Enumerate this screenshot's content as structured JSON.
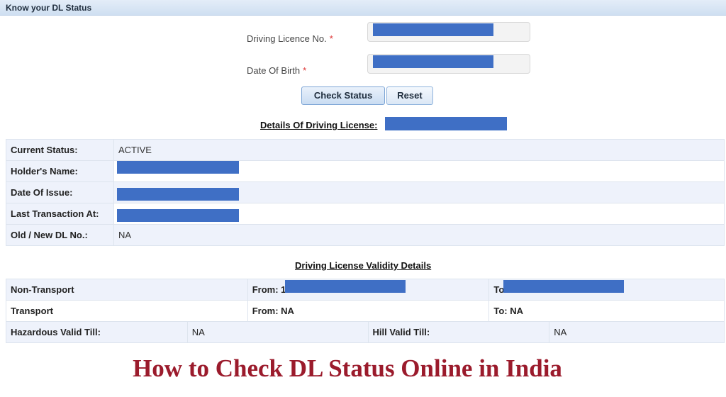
{
  "header": {
    "title": "Know your DL Status"
  },
  "form": {
    "licence_label": "Driving Licence No.",
    "dob_label": "Date Of Birth",
    "required_mark": "*",
    "check_button": "Check Status",
    "reset_button": "Reset"
  },
  "details": {
    "heading": "Details Of Driving License:",
    "rows": [
      {
        "label": "Current Status:",
        "value": "ACTIVE"
      },
      {
        "label": "Holder's Name:",
        "value": ""
      },
      {
        "label": "Date Of Issue:",
        "value": ""
      },
      {
        "label": "Last Transaction At:",
        "value": ""
      },
      {
        "label": "Old / New DL No.:",
        "value": "NA"
      }
    ]
  },
  "validity": {
    "heading": "Driving License Validity Details",
    "non_transport": {
      "label": "Non-Transport",
      "from": "From: 1",
      "to": "To:"
    },
    "transport": {
      "label": "Transport",
      "from": "From: NA",
      "to": "To: NA"
    },
    "hazardous": {
      "label": "Hazardous Valid Till:",
      "value": "NA"
    },
    "hill": {
      "label": "Hill Valid Till:",
      "value": "NA"
    }
  },
  "footer": {
    "caption": "How to Check DL Status Online in India"
  },
  "colors": {
    "redaction": "#3f6fc5",
    "caption": "#9b1b2c",
    "header_bg": "#d6e4f4"
  }
}
